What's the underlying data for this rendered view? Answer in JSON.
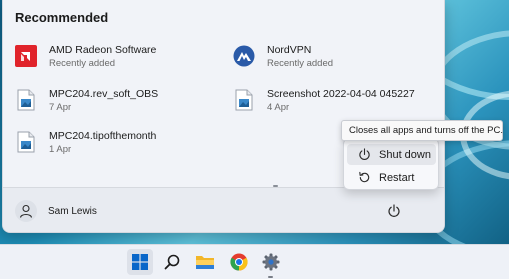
{
  "recommended": {
    "title": "Recommended",
    "items": [
      {
        "name": "AMD Radeon Software",
        "sub": "Recently added",
        "icon": "amd-radeon-icon"
      },
      {
        "name": "NordVPN",
        "sub": "Recently added",
        "icon": "nordvpn-icon"
      },
      {
        "name": "MPC204.rev_soft_OBS",
        "sub": "7 Apr",
        "icon": "image-file-icon"
      },
      {
        "name": "Screenshot 2022-04-04 045227",
        "sub": "4 Apr",
        "icon": "image-file-icon"
      },
      {
        "name": "MPC204.tipofthemonth",
        "sub": "1 Apr",
        "icon": "image-file-icon"
      }
    ]
  },
  "user": {
    "name": "Sam Lewis",
    "icon": "user-icon"
  },
  "power_menu": {
    "tooltip": "Closes all apps and turns off the PC.",
    "items": [
      {
        "label": "Shut down",
        "icon": "power-icon"
      },
      {
        "label": "Restart",
        "icon": "restart-icon"
      }
    ]
  },
  "taskbar": {
    "apps": [
      "start-icon",
      "search-icon",
      "file-explorer-icon",
      "chrome-icon",
      "settings-icon"
    ]
  },
  "colors": {
    "menu_bg": "#f1f3f8",
    "amd_red": "#e0232b",
    "nord_blue": "#2a5aa8",
    "win_blue": "#0a67c9"
  }
}
